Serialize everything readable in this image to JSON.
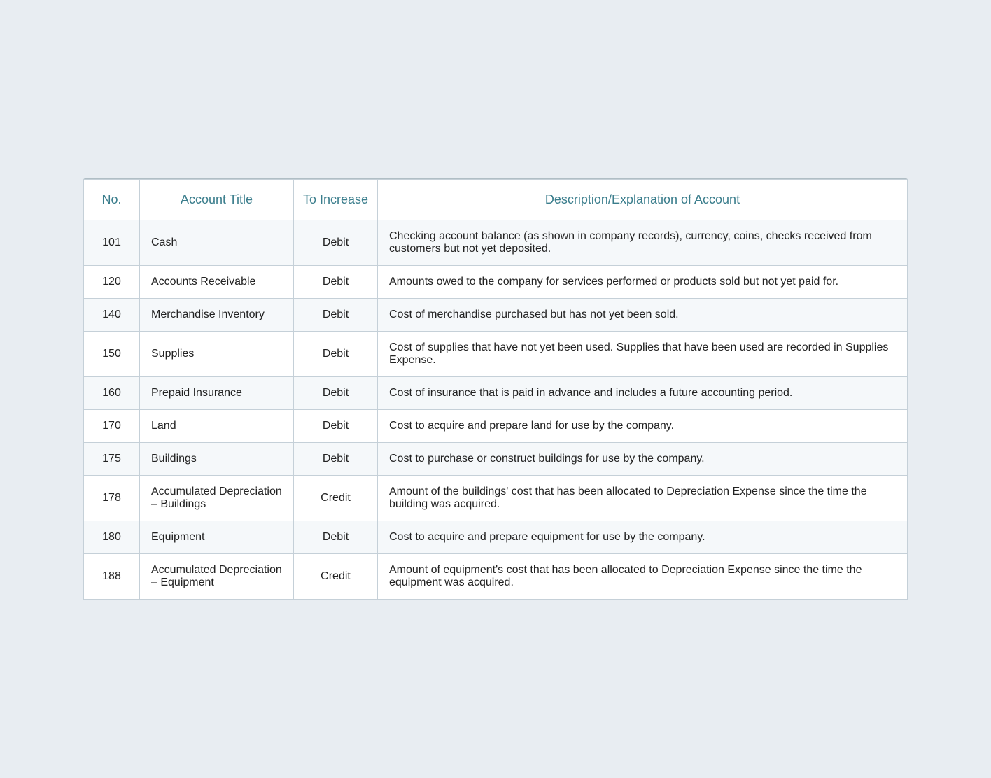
{
  "table": {
    "headers": {
      "no": "No.",
      "account_title": "Account Title",
      "to_increase": "To Increase",
      "description": "Description/Explanation of Account"
    },
    "rows": [
      {
        "no": "101",
        "account_title": "Cash",
        "to_increase": "Debit",
        "description": "Checking account balance (as shown in company records), currency, coins, checks received from customers but not yet deposited."
      },
      {
        "no": "120",
        "account_title": "Accounts Receivable",
        "to_increase": "Debit",
        "description": "Amounts owed to the company for services performed or products sold but not yet paid for."
      },
      {
        "no": "140",
        "account_title": "Merchandise Inventory",
        "to_increase": "Debit",
        "description": "Cost of merchandise purchased but has not yet been sold."
      },
      {
        "no": "150",
        "account_title": "Supplies",
        "to_increase": "Debit",
        "description": "Cost of supplies that have not yet been used. Supplies that have been used are recorded in Supplies Expense."
      },
      {
        "no": "160",
        "account_title": "Prepaid Insurance",
        "to_increase": "Debit",
        "description": "Cost of insurance that is paid in advance and includes a future accounting period."
      },
      {
        "no": "170",
        "account_title": "Land",
        "to_increase": "Debit",
        "description": "Cost to acquire and prepare land for use by the company."
      },
      {
        "no": "175",
        "account_title": "Buildings",
        "to_increase": "Debit",
        "description": "Cost to purchase or construct buildings for use by the company."
      },
      {
        "no": "178",
        "account_title": "Accumulated Depreciation – Buildings",
        "to_increase": "Credit",
        "description": "Amount of the buildings' cost that has been allocated to Depreciation Expense since the time the building was acquired."
      },
      {
        "no": "180",
        "account_title": "Equipment",
        "to_increase": "Debit",
        "description": "Cost to acquire and prepare equipment for use by the company."
      },
      {
        "no": "188",
        "account_title": "Accumulated Depreciation – Equipment",
        "to_increase": "Credit",
        "description": "Amount of equipment's cost that has been allocated to Depreciation Expense since the time the equipment was acquired."
      }
    ]
  }
}
